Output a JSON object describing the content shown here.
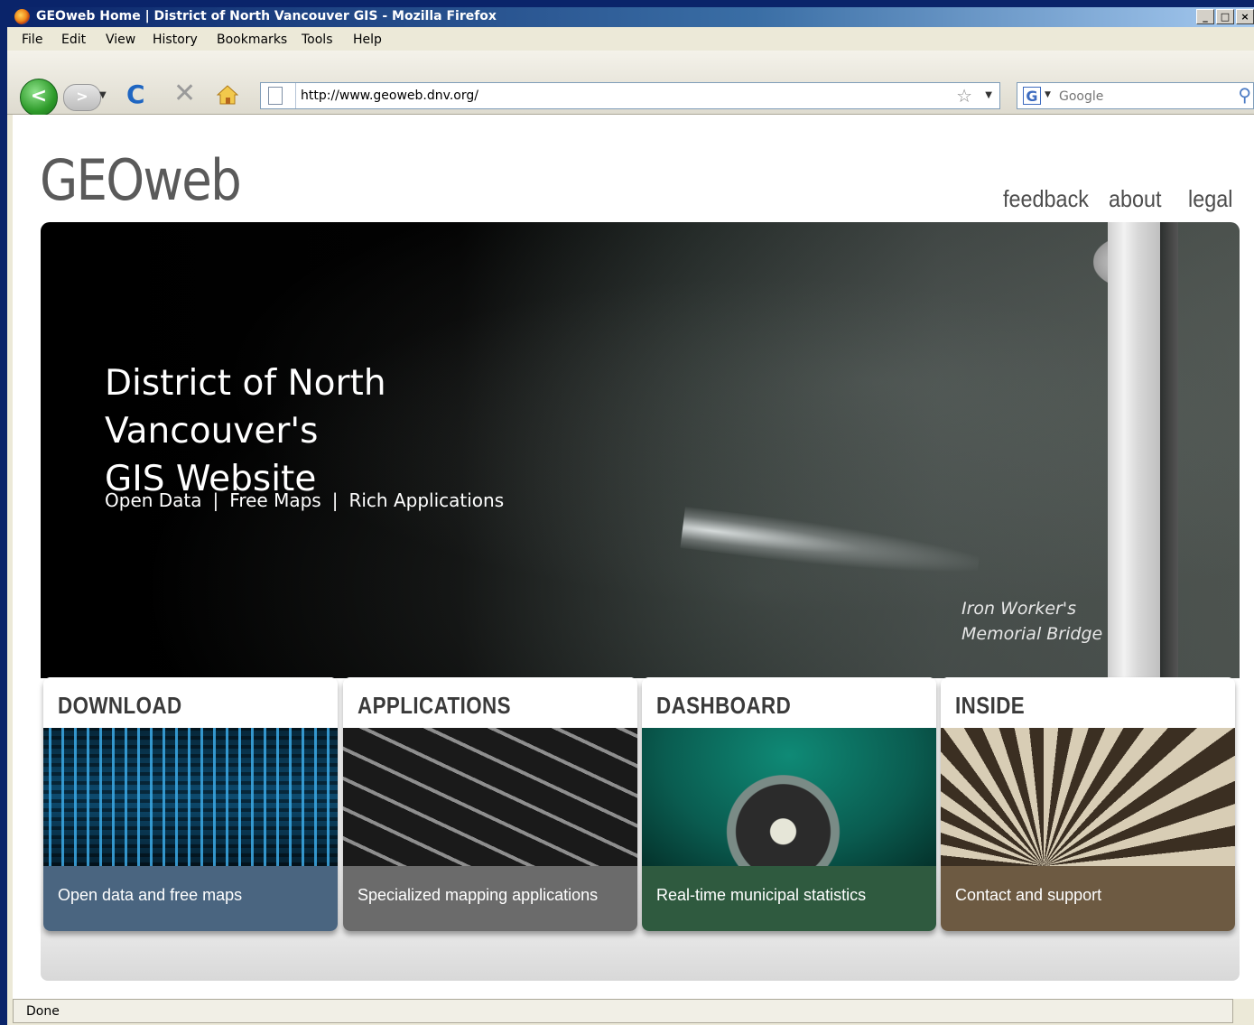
{
  "window": {
    "title": "GEOweb Home | District of North Vancouver GIS - Mozilla Firefox",
    "controls": [
      "_",
      "□",
      "×"
    ]
  },
  "menu": [
    "File",
    "Edit",
    "View",
    "History",
    "Bookmarks",
    "Tools",
    "Help"
  ],
  "toolbar": {
    "back_glyph": "<",
    "forward_glyph": ">",
    "reload_glyph": "C",
    "stop_glyph": "✕",
    "url": "http://www.geoweb.dnv.org/",
    "search_placeholder": "Google",
    "search_engine_glyph": "G"
  },
  "site": {
    "logo": "GEOweb",
    "nav": [
      "feedback",
      "about",
      "legal"
    ]
  },
  "hero": {
    "title_line1": "District of North Vancouver's",
    "title_line2": "GIS Website",
    "tagline": [
      "Open Data",
      "Free Maps",
      "Rich Applications"
    ],
    "separator": "|",
    "caption_line1": "Iron Worker's",
    "caption_line2": "Memorial Bridge"
  },
  "tiles": [
    {
      "title": "DOWNLOAD",
      "description": "Open data and free maps",
      "color": "#4a6580"
    },
    {
      "title": "APPLICATIONS",
      "description": "Specialized mapping applications",
      "color": "#6b6b6b"
    },
    {
      "title": "DASHBOARD",
      "description": "Real-time municipal statistics",
      "color": "#2f5a3f"
    },
    {
      "title": "INSIDE",
      "description": "Contact and support",
      "color": "#6d5a42"
    }
  ],
  "status": "Done"
}
